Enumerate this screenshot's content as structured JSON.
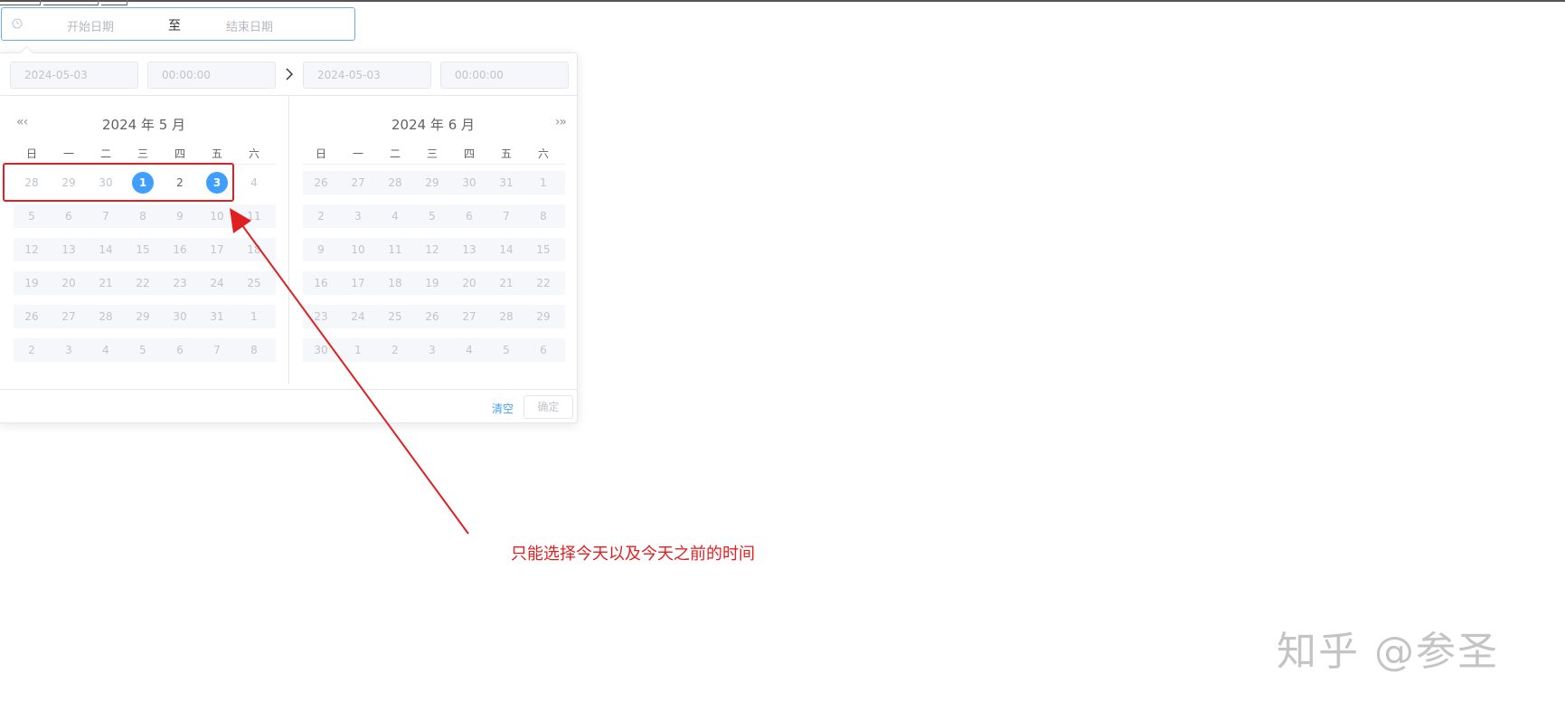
{
  "range_input": {
    "icon": "clock-icon",
    "start_placeholder": "开始日期",
    "separator": "至",
    "end_placeholder": "结束日期"
  },
  "time_header": {
    "start_date": "2024-05-03",
    "start_time": "00:00:00",
    "end_date": "2024-05-03",
    "end_time": "00:00:00"
  },
  "weekdays": [
    "日",
    "一",
    "二",
    "三",
    "四",
    "五",
    "六"
  ],
  "left_calendar": {
    "title": "2024 年 5 月",
    "nav": "«‹",
    "rows": [
      [
        "28",
        "29",
        "30",
        "1",
        "2",
        "3",
        "4"
      ],
      [
        "5",
        "6",
        "7",
        "8",
        "9",
        "10",
        "11"
      ],
      [
        "12",
        "13",
        "14",
        "15",
        "16",
        "17",
        "18"
      ],
      [
        "19",
        "20",
        "21",
        "22",
        "23",
        "24",
        "25"
      ],
      [
        "26",
        "27",
        "28",
        "29",
        "30",
        "31",
        "1"
      ],
      [
        "2",
        "3",
        "4",
        "5",
        "6",
        "7",
        "8"
      ]
    ],
    "available": [
      "0-3",
      "0-4",
      "0-5"
    ],
    "selected": [
      "0-3",
      "0-5"
    ]
  },
  "right_calendar": {
    "title": "2024 年 6 月",
    "nav": "›»",
    "rows": [
      [
        "26",
        "27",
        "28",
        "29",
        "30",
        "31",
        "1"
      ],
      [
        "2",
        "3",
        "4",
        "5",
        "6",
        "7",
        "8"
      ],
      [
        "9",
        "10",
        "11",
        "12",
        "13",
        "14",
        "15"
      ],
      [
        "16",
        "17",
        "18",
        "19",
        "20",
        "21",
        "22"
      ],
      [
        "23",
        "24",
        "25",
        "26",
        "27",
        "28",
        "29"
      ],
      [
        "30",
        "1",
        "2",
        "3",
        "4",
        "5",
        "6"
      ]
    ]
  },
  "footer": {
    "clear_label": "清空",
    "ok_label": "确定"
  },
  "annotation": {
    "text": "只能选择今天以及今天之前的时间",
    "color": "#e02020"
  },
  "watermark": "知乎 @参圣",
  "colors": {
    "accent": "#409eff",
    "disabled_text": "#c0c4cc",
    "disabled_bg": "#f5f7fa"
  }
}
